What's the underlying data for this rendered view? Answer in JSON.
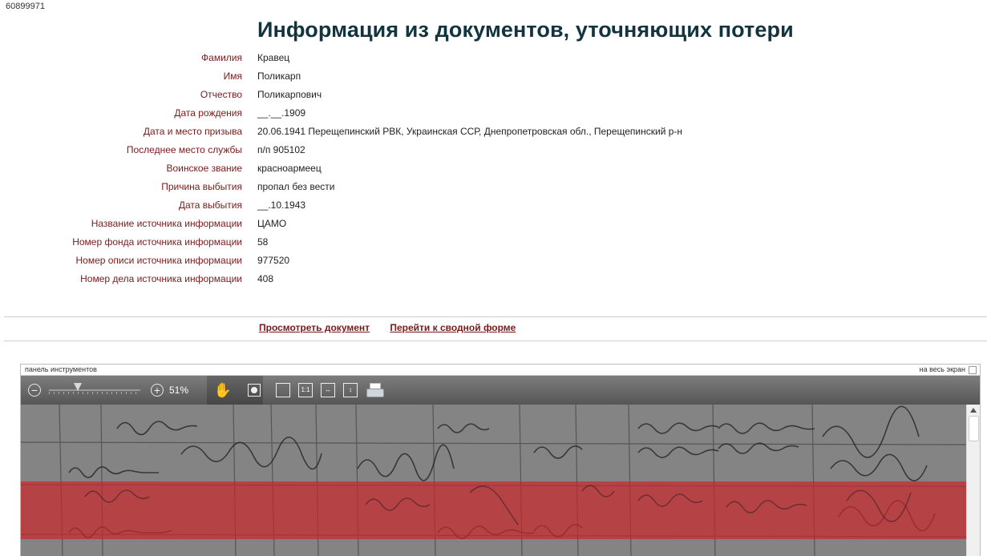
{
  "record_id": "60899971",
  "title": "Информация из документов, уточняющих потери",
  "fields": [
    {
      "label": "Фамилия",
      "value": "Кравец"
    },
    {
      "label": "Имя",
      "value": "Поликарп"
    },
    {
      "label": "Отчество",
      "value": "Поликарпович"
    },
    {
      "label": "Дата рождения",
      "value": "__.__.1909"
    },
    {
      "label": "Дата и место призыва",
      "value": "20.06.1941 Перещепинский РВК, Украинская ССР, Днепропетровская обл., Перещепинский р-н"
    },
    {
      "label": "Последнее место службы",
      "value": "п/п 905102"
    },
    {
      "label": "Воинское звание",
      "value": "красноармеец"
    },
    {
      "label": "Причина выбытия",
      "value": "пропал без вести"
    },
    {
      "label": "Дата выбытия",
      "value": "__.10.1943"
    },
    {
      "label": "Название источника информации",
      "value": "ЦАМО"
    },
    {
      "label": "Номер фонда источника информации",
      "value": "58"
    },
    {
      "label": "Номер описи источника информации",
      "value": "977520"
    },
    {
      "label": "Номер дела источника информации",
      "value": "408"
    }
  ],
  "links": {
    "view_document": "Просмотреть документ",
    "summary_form": "Перейти к сводной форме"
  },
  "viewer": {
    "panel_title": "панель инструментов",
    "fullscreen_label": "на весь экран",
    "zoom_percent": 51,
    "zoom_label": "51%",
    "fit_actual_size_label": "1:1",
    "highlight_color": "#c8282d"
  }
}
